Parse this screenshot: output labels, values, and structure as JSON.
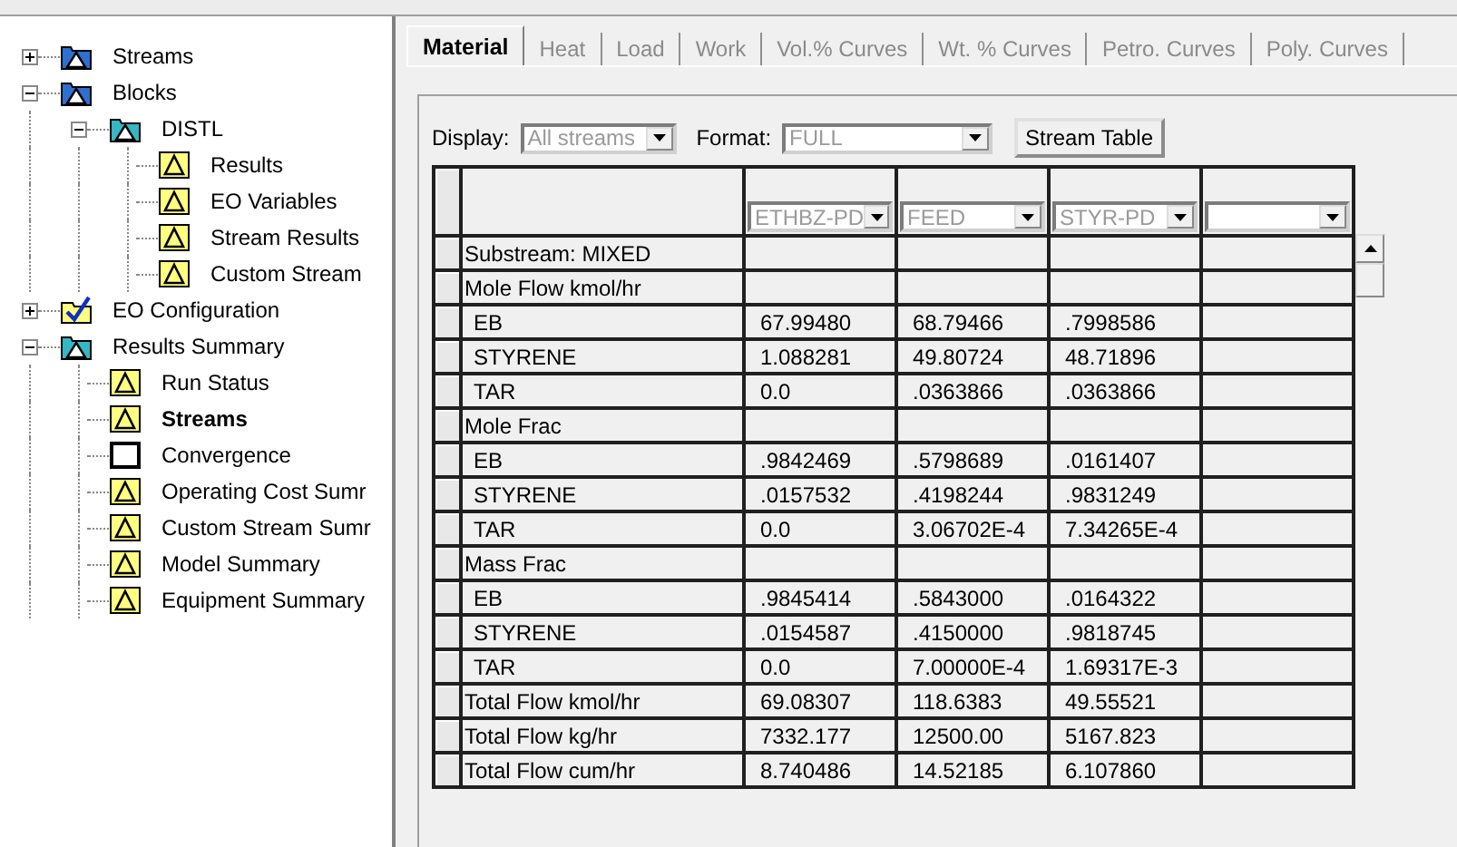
{
  "tree": [
    {
      "label": "Streams",
      "kind": "folder",
      "expanded": false,
      "selected": false
    },
    {
      "label": "Blocks",
      "kind": "folder",
      "expanded": true,
      "selected": false,
      "children": [
        {
          "label": "DISTL",
          "kind": "subfolder",
          "expanded": true,
          "selected": false,
          "children": [
            {
              "label": "Results",
              "kind": "form",
              "selected": false
            },
            {
              "label": "EO Variables",
              "kind": "form",
              "selected": false
            },
            {
              "label": "Stream Results",
              "kind": "form",
              "selected": false
            },
            {
              "label": "Custom Stream",
              "kind": "form",
              "selected": false
            }
          ]
        }
      ]
    },
    {
      "label": "EO Configuration",
      "kind": "config",
      "expanded": false,
      "selected": false
    },
    {
      "label": "Results Summary",
      "kind": "subfolder",
      "expanded": true,
      "selected": false,
      "children": [
        {
          "label": "Run Status",
          "kind": "form",
          "selected": false
        },
        {
          "label": "Streams",
          "kind": "form",
          "selected": true
        },
        {
          "label": "Convergence",
          "kind": "blank",
          "selected": false
        },
        {
          "label": "Operating Cost Sumr",
          "kind": "form",
          "selected": false
        },
        {
          "label": "Custom Stream Sumr",
          "kind": "form",
          "selected": false
        },
        {
          "label": "Model Summary",
          "kind": "form",
          "selected": false
        },
        {
          "label": "Equipment Summary",
          "kind": "form",
          "selected": false
        }
      ]
    }
  ],
  "tabs": [
    {
      "label": "Material",
      "selected": true
    },
    {
      "label": "Heat",
      "selected": false
    },
    {
      "label": "Load",
      "selected": false
    },
    {
      "label": "Work",
      "selected": false
    },
    {
      "label": "Vol.% Curves",
      "selected": false
    },
    {
      "label": "Wt. % Curves",
      "selected": false
    },
    {
      "label": "Petro. Curves",
      "selected": false
    },
    {
      "label": "Poly. Curves",
      "selected": false
    }
  ],
  "display": {
    "label": "Display:",
    "value": "All streams"
  },
  "format": {
    "label": "Format:",
    "value": "FULL"
  },
  "stream_table_button": "Stream Table",
  "table": {
    "columns": [
      "ETHBZ-PD",
      "FEED",
      "STYR-PD"
    ],
    "rows": [
      {
        "kind": "section",
        "label": "Substream: MIXED"
      },
      {
        "kind": "section",
        "label": "Mole Flow kmol/hr"
      },
      {
        "kind": "component",
        "label": "EB",
        "values": [
          "67.99480",
          "68.79466",
          ".7998586"
        ]
      },
      {
        "kind": "component",
        "label": "STYRENE",
        "values": [
          "1.088281",
          "49.80724",
          "48.71896"
        ]
      },
      {
        "kind": "component",
        "label": "TAR",
        "values": [
          "0.0",
          ".0363866",
          ".0363866"
        ]
      },
      {
        "kind": "section",
        "label": "Mole Frac"
      },
      {
        "kind": "component",
        "label": "EB",
        "values": [
          ".9842469",
          ".5798689",
          ".0161407"
        ]
      },
      {
        "kind": "component",
        "label": "STYRENE",
        "values": [
          ".0157532",
          ".4198244",
          ".9831249"
        ]
      },
      {
        "kind": "component",
        "label": "TAR",
        "values": [
          "0.0",
          "3.06702E-4",
          "7.34265E-4"
        ]
      },
      {
        "kind": "section",
        "label": "Mass Frac"
      },
      {
        "kind": "component",
        "label": "EB",
        "values": [
          ".9845414",
          ".5843000",
          ".0164322"
        ]
      },
      {
        "kind": "component",
        "label": "STYRENE",
        "values": [
          ".0154587",
          ".4150000",
          ".9818745"
        ]
      },
      {
        "kind": "component",
        "label": "TAR",
        "values": [
          "0.0",
          "7.00000E-4",
          "1.69317E-3"
        ]
      },
      {
        "kind": "total",
        "label": "Total Flow kmol/hr",
        "values": [
          "69.08307",
          "118.6383",
          "49.55521"
        ]
      },
      {
        "kind": "total",
        "label": "Total Flow kg/hr",
        "values": [
          "7332.177",
          "12500.00",
          "5167.823"
        ]
      },
      {
        "kind": "total",
        "label": "Total Flow cum/hr",
        "values": [
          "8.740486",
          "14.52185",
          "6.107860"
        ]
      }
    ]
  }
}
